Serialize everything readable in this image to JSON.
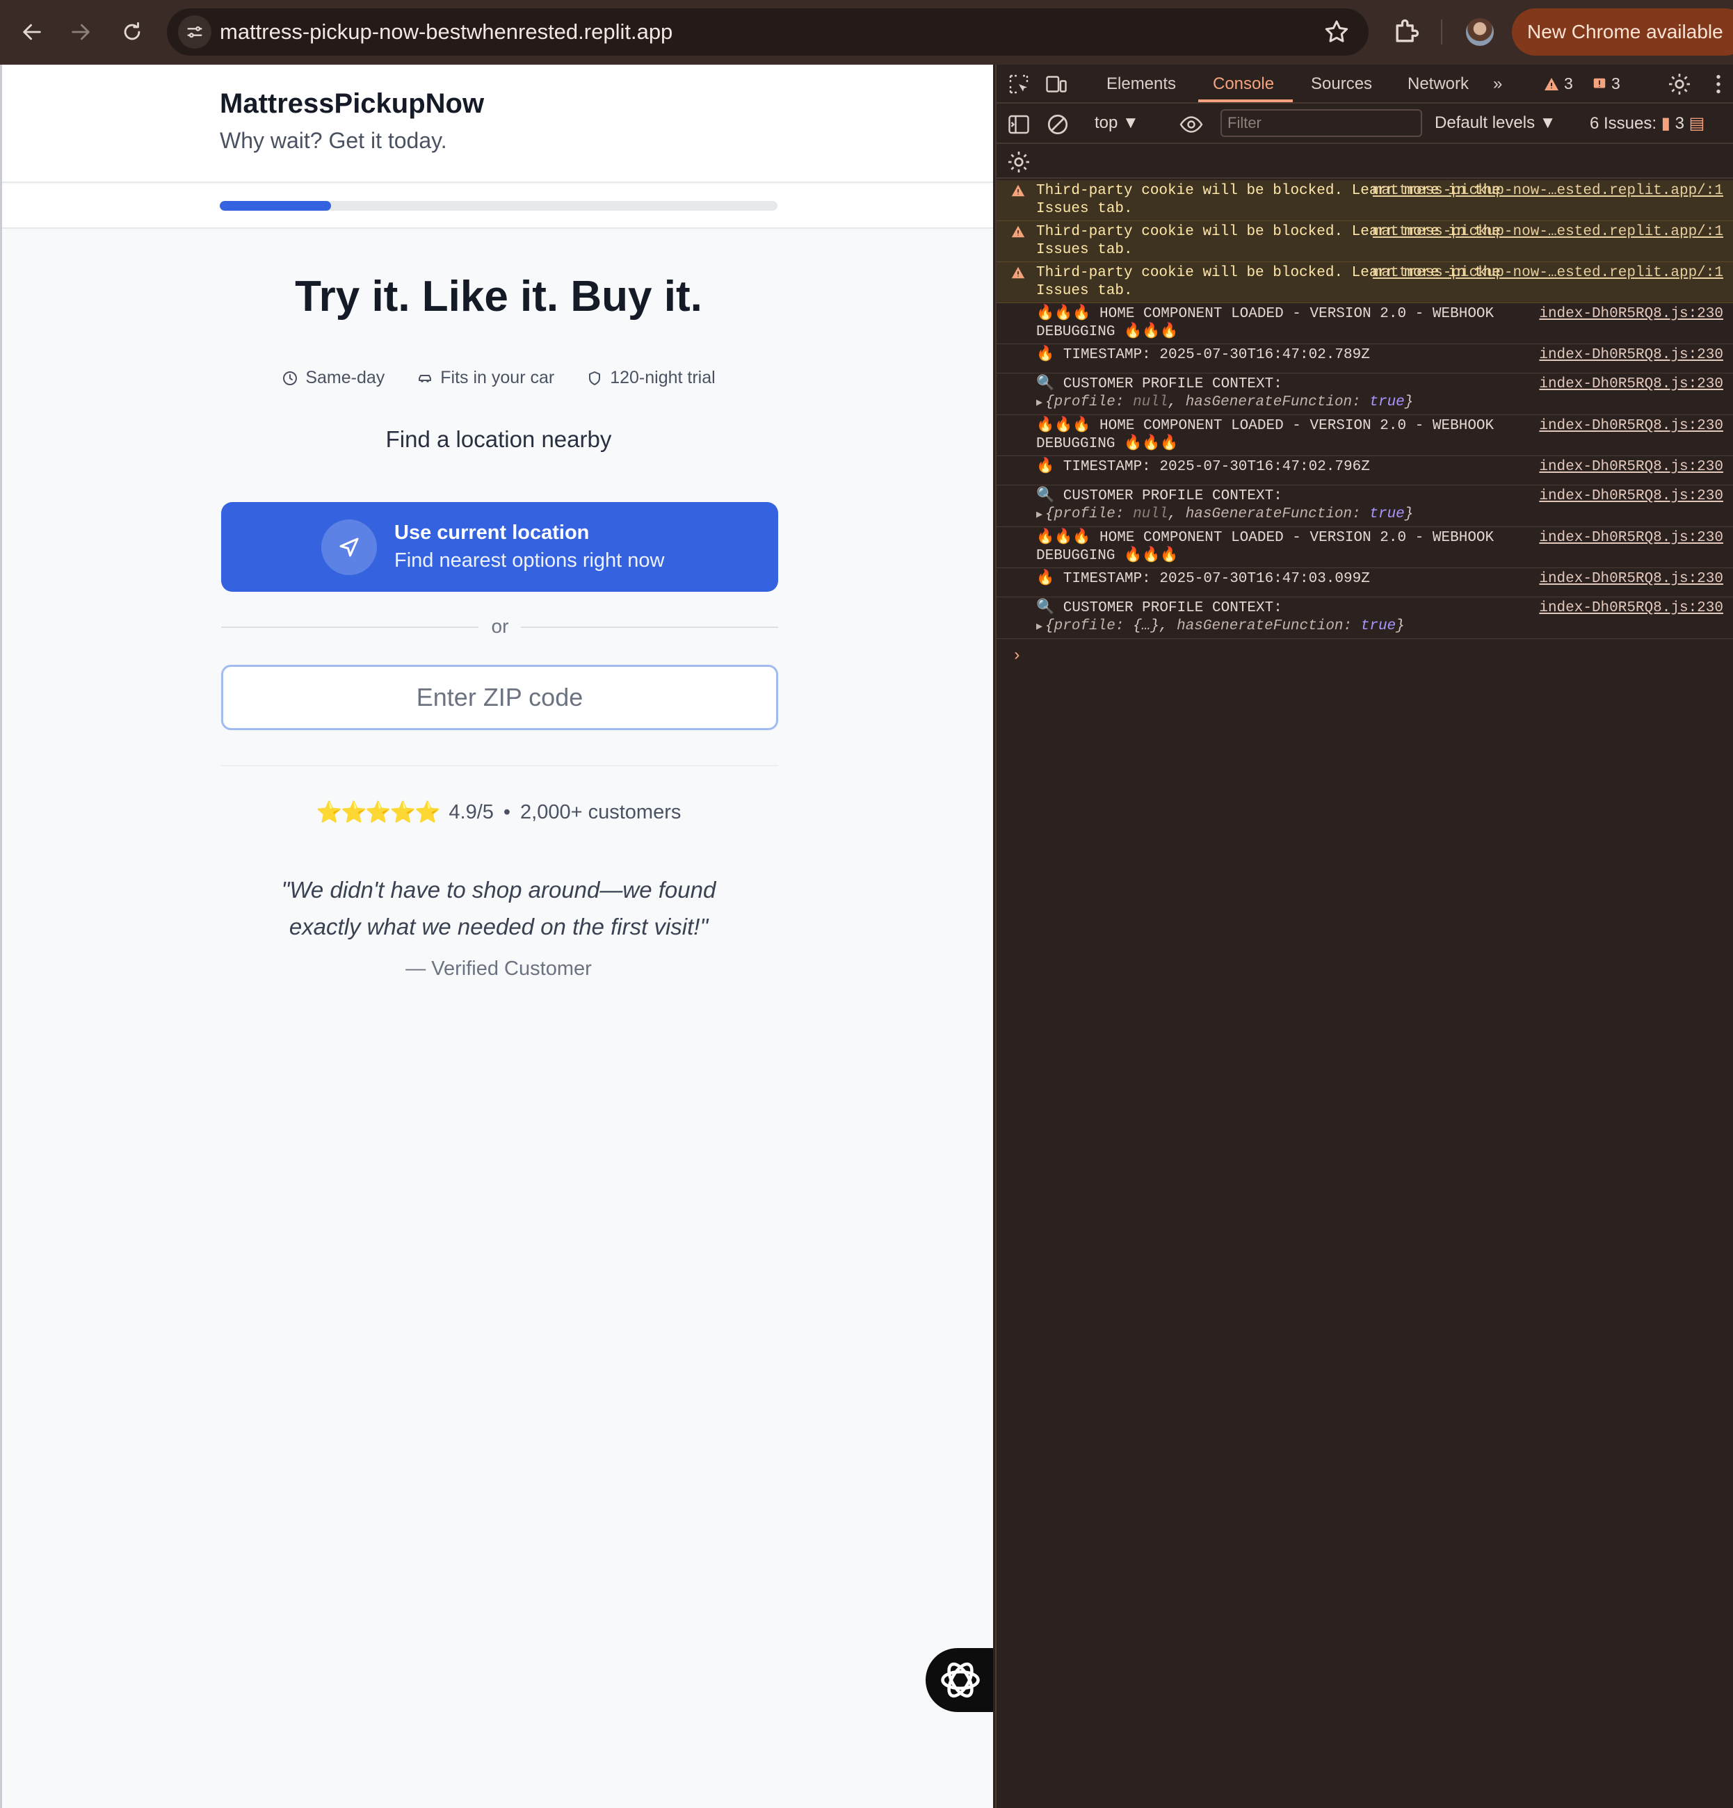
{
  "browser": {
    "url": "mattress-pickup-now-bestwhenrested.replit.app",
    "update_label": "New Chrome available"
  },
  "site": {
    "brand": "MattressPickupNow",
    "tagline": "Why wait? Get it today.",
    "progress_fraction": 0.2,
    "headline": "Try it. Like it. Buy it.",
    "features": [
      "Same-day",
      "Fits in your car",
      "120-night trial"
    ],
    "find_label": "Find a location nearby",
    "location_button": {
      "title": "Use current location",
      "subtitle": "Find nearest options right now"
    },
    "or_label": "or",
    "zip_placeholder": "Enter ZIP code",
    "rating": {
      "stars": "⭐⭐⭐⭐⭐",
      "score": "4.9/5",
      "separator": "•",
      "customers": "2,000+ customers"
    },
    "quote": "\"We didn't have to shop around—we found exactly what we needed on the first visit!\"",
    "attribution": "— Verified Customer"
  },
  "devtools": {
    "tabs": [
      "Elements",
      "Console",
      "Sources",
      "Network"
    ],
    "active_tab": "Console",
    "warning_count": "3",
    "error_count": "3",
    "context": "top",
    "filter_placeholder": "Filter",
    "levels": "Default levels",
    "issues_label": "6 Issues:",
    "issues_count": "3",
    "messages": [
      {
        "type": "warn",
        "text": "Third-party cookie will be blocked. Learn more in the Issues tab.",
        "source": "mattress-pickup-now-…ested.replit.app/:1"
      },
      {
        "type": "warn",
        "text": "Third-party cookie will be blocked. Learn more in the Issues tab.",
        "source": "mattress-pickup-now-…ested.replit.app/:1"
      },
      {
        "type": "warn",
        "text": "Third-party cookie will be blocked. Learn more in the Issues tab.",
        "source": "mattress-pickup-now-…ested.replit.app/:1"
      },
      {
        "type": "log",
        "text": "🔥🔥🔥 HOME COMPONENT LOADED - VERSION 2.0 - WEBHOOK DEBUGGING 🔥🔥🔥",
        "source": "index-Dh0R5RQ8.js:230"
      },
      {
        "type": "log",
        "text": "🔥 TIMESTAMP: 2025-07-30T16:47:02.789Z",
        "source": "index-Dh0R5RQ8.js:230"
      },
      {
        "type": "log",
        "text": "🔍 CUSTOMER PROFILE CONTEXT:",
        "source": "index-Dh0R5RQ8.js:230",
        "object": {
          "profile": "null",
          "hasGenerateFunction": "true"
        }
      },
      {
        "type": "log",
        "text": "🔥🔥🔥 HOME COMPONENT LOADED - VERSION 2.0 - WEBHOOK DEBUGGING 🔥🔥🔥",
        "source": "index-Dh0R5RQ8.js:230"
      },
      {
        "type": "log",
        "text": "🔥 TIMESTAMP: 2025-07-30T16:47:02.796Z",
        "source": "index-Dh0R5RQ8.js:230"
      },
      {
        "type": "log",
        "text": "🔍 CUSTOMER PROFILE CONTEXT:",
        "source": "index-Dh0R5RQ8.js:230",
        "object": {
          "profile": "null",
          "hasGenerateFunction": "true"
        }
      },
      {
        "type": "log",
        "text": "🔥🔥🔥 HOME COMPONENT LOADED - VERSION 2.0 - WEBHOOK DEBUGGING 🔥🔥🔥",
        "source": "index-Dh0R5RQ8.js:230"
      },
      {
        "type": "log",
        "text": "🔥 TIMESTAMP: 2025-07-30T16:47:03.099Z",
        "source": "index-Dh0R5RQ8.js:230"
      },
      {
        "type": "log",
        "text": "🔍 CUSTOMER PROFILE CONTEXT:",
        "source": "index-Dh0R5RQ8.js:230",
        "object": {
          "profile": "{…}",
          "hasGenerateFunction": "true"
        }
      }
    ],
    "prompt": "›"
  },
  "colors": {
    "accent": "#3563e0",
    "devtools_active": "#f5a37d",
    "warning_bg": "#3e3320"
  }
}
